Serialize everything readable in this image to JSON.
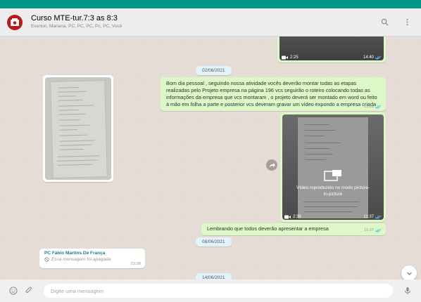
{
  "colors": {
    "accent_teal": "#009688",
    "outgoing_bubble": "#dcf8c6",
    "incoming_bubble": "#ffffff",
    "date_chip": "#e1f3fb",
    "read_tick": "#4fc3f7",
    "chat_background": "#e5ddd5"
  },
  "header": {
    "title": "Curso MTE-tur.7:3 as 8:3",
    "members": "Everton, Mariana, PC, PC, PC, Pc, PC, Você",
    "avatar_icon": "group-avatar",
    "search_icon": "search-icon",
    "menu_icon": "kebab-menu-icon"
  },
  "messages": [
    {
      "kind": "video",
      "direction": "out",
      "duration": "2:25",
      "time": "14:40",
      "status": "read"
    },
    {
      "kind": "date",
      "label": "02/06/2021"
    },
    {
      "kind": "image",
      "direction": "in"
    },
    {
      "kind": "text",
      "direction": "out",
      "text": "Bom dia pessoal , seguindo nossa atividade vocês deverão montar todas as etapas realizadas pelo Projeto empresa na página 196 vcs seguirão o roteiro colocando todas as informações da empresa que vcs montaram , o projeto deverá ser montado em word ou feito à mão em folha a parte e posterior vcs deveram gravar um vídeo expondo a empresa criada .",
      "time": "11:21",
      "status": "read"
    },
    {
      "kind": "video",
      "direction": "out",
      "duration": "2:38",
      "time": "11:37",
      "status": "read",
      "overlay_text": "Vídeo reproduzido no modo picture-in-picture"
    },
    {
      "kind": "text",
      "direction": "out",
      "text": "Lembrando que todos deverão apresentar a empresa",
      "time": "11:37",
      "status": "read"
    },
    {
      "kind": "date",
      "label": "08/06/2021"
    },
    {
      "kind": "deleted",
      "direction": "in",
      "sender": "PC Fábio Martins De França",
      "text": "Essa mensagem foi apagada",
      "time": "23:38"
    },
    {
      "kind": "date",
      "label": "14/06/2021"
    }
  ],
  "footer": {
    "placeholder": "Digite uma mensagem",
    "emoji_icon": "emoji-icon",
    "attach_icon": "paperclip-icon",
    "mic_icon": "microphone-icon"
  }
}
